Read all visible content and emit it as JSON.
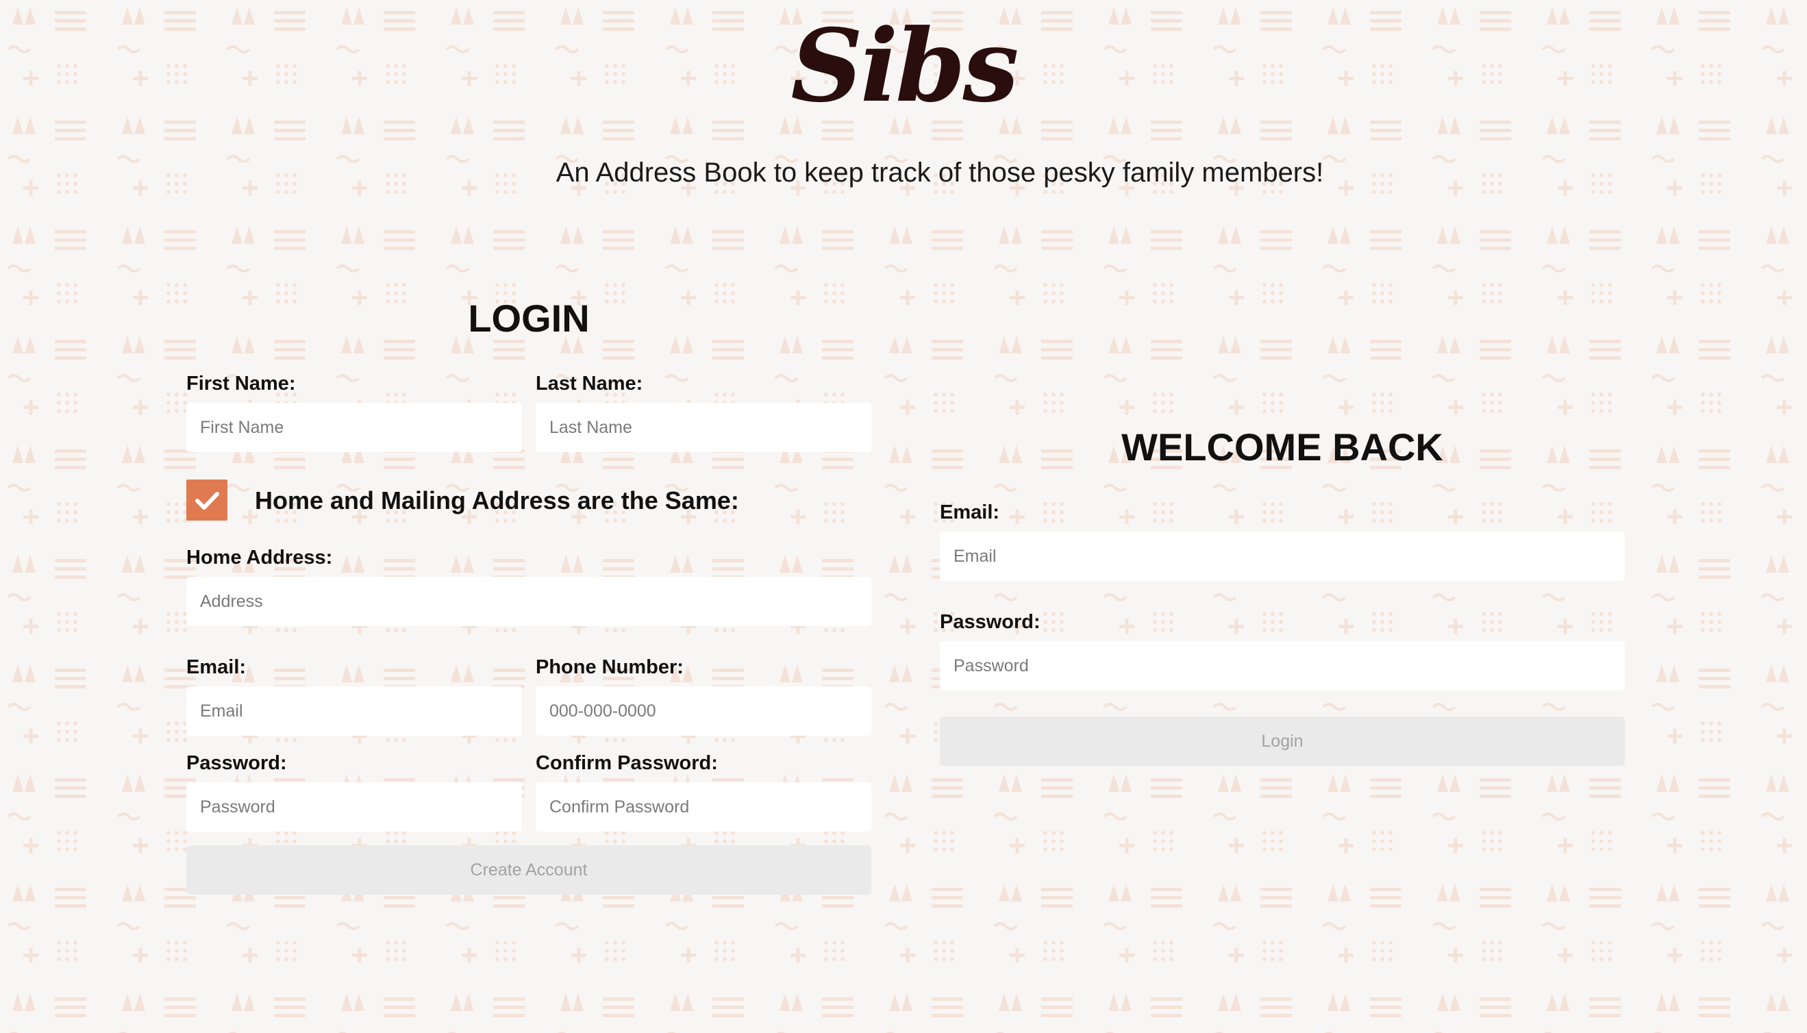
{
  "app": {
    "logo": "Sibs",
    "tagline": "An Address Book to keep track of those pesky family members!"
  },
  "signup": {
    "heading": "LOGIN",
    "first_name": {
      "label": "First Name:",
      "placeholder": "First Name"
    },
    "last_name": {
      "label": "Last Name:",
      "placeholder": "Last Name"
    },
    "same_address": {
      "label": "Home and Mailing Address are the Same:",
      "checked": true
    },
    "home_address": {
      "label": "Home Address:",
      "placeholder": "Address"
    },
    "email": {
      "label": "Email:",
      "placeholder": "Email"
    },
    "phone": {
      "label": "Phone Number:",
      "placeholder": "000-000-0000"
    },
    "password": {
      "label": "Password:",
      "placeholder": "Password"
    },
    "confirm_password": {
      "label": "Confirm Password:",
      "placeholder": "Confirm Password"
    },
    "submit_label": "Create Account"
  },
  "login": {
    "heading": "WELCOME BACK",
    "email": {
      "label": "Email:",
      "placeholder": "Email"
    },
    "password": {
      "label": "Password:",
      "placeholder": "Password"
    },
    "submit_label": "Login"
  },
  "colors": {
    "background": "#f8f6f4",
    "pattern": "#f4e4dc",
    "checkbox_accent": "#e07a50",
    "logo": "#2a0d0d",
    "disabled_button": "#eaeaea"
  },
  "icons": {
    "checkbox_mark": "check-icon"
  }
}
